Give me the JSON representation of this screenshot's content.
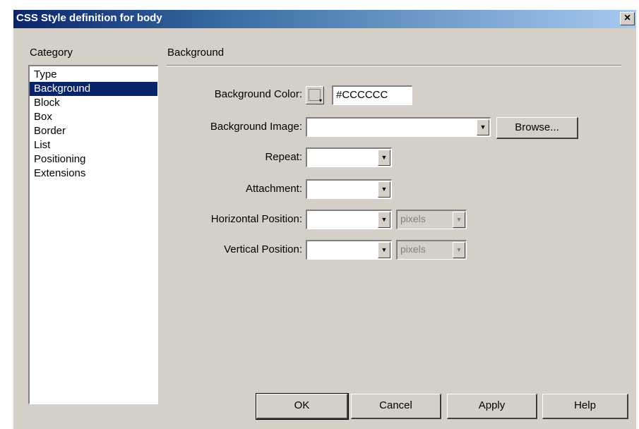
{
  "window": {
    "title": "CSS Style definition for body",
    "close_glyph": "×"
  },
  "category": {
    "header": "Category",
    "items": [
      "Type",
      "Background",
      "Block",
      "Box",
      "Border",
      "List",
      "Positioning",
      "Extensions"
    ],
    "selected": "Background"
  },
  "panel": {
    "title": "Background"
  },
  "fields": {
    "bg_color_label": "Background Color:",
    "bg_color_value": "#CCCCCC",
    "bg_color_swatch": "#d4d0c8",
    "bg_image_label": "Background Image:",
    "bg_image_value": "",
    "browse_label": "Browse...",
    "repeat_label": "Repeat:",
    "repeat_value": "",
    "attachment_label": "Attachment:",
    "attachment_value": "",
    "hpos_label": "Horizontal Position:",
    "hpos_value": "",
    "hpos_unit": "pixels",
    "vpos_label": "Vertical Position:",
    "vpos_value": "",
    "vpos_unit": "pixels"
  },
  "buttons": {
    "ok": "OK",
    "cancel": "Cancel",
    "apply": "Apply",
    "help": "Help"
  },
  "icons": {
    "dropdown_arrow": "▼",
    "swatch_arrow": "▾"
  }
}
